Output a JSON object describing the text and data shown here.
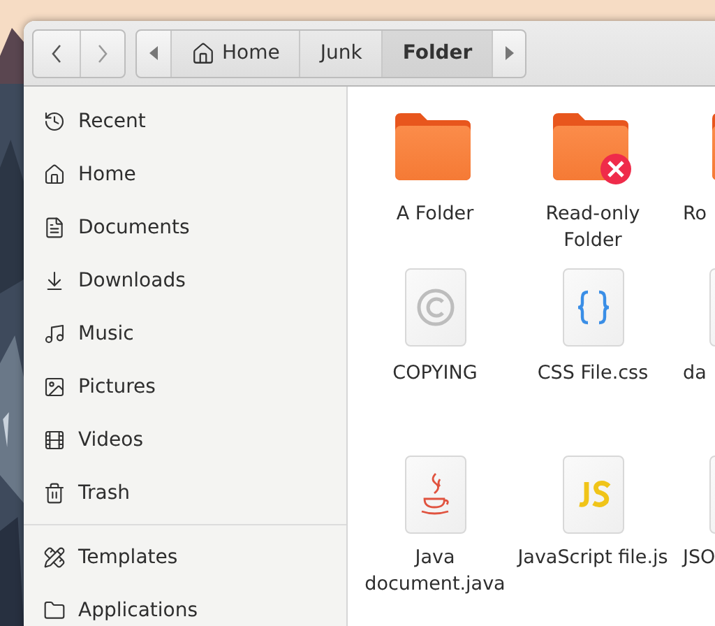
{
  "toolbar": {
    "breadcrumbs": [
      {
        "label": "Home",
        "kind": "home",
        "selected": false
      },
      {
        "label": "Junk",
        "kind": "plain",
        "selected": false
      },
      {
        "label": "Folder",
        "kind": "plain",
        "selected": true
      }
    ]
  },
  "sidebar": {
    "groups": [
      {
        "items": [
          {
            "label": "Recent",
            "kind": "recent"
          },
          {
            "label": "Home",
            "kind": "home"
          },
          {
            "label": "Documents",
            "kind": "documents"
          },
          {
            "label": "Downloads",
            "kind": "downloads"
          },
          {
            "label": "Music",
            "kind": "music"
          },
          {
            "label": "Pictures",
            "kind": "pictures"
          },
          {
            "label": "Videos",
            "kind": "videos"
          },
          {
            "label": "Trash",
            "kind": "trash"
          }
        ]
      },
      {
        "items": [
          {
            "label": "Templates",
            "kind": "templates"
          },
          {
            "label": "Applications",
            "kind": "applications"
          }
        ]
      }
    ]
  },
  "files": [
    {
      "name": "A Folder",
      "kind": "folder",
      "partial": false
    },
    {
      "name": "Read-only Folder",
      "kind": "folder-readonly",
      "partial": false
    },
    {
      "name": "Ro",
      "kind": "folder",
      "partial": true
    },
    {
      "name": "COPYING",
      "kind": "copyright",
      "partial": false
    },
    {
      "name": "CSS File.css",
      "kind": "css",
      "partial": false
    },
    {
      "name": "da",
      "kind": "blank",
      "partial": true
    },
    {
      "name": "Java document.java",
      "kind": "java",
      "partial": false
    },
    {
      "name": "JavaScript file.js",
      "kind": "js",
      "partial": false
    },
    {
      "name": "JSO",
      "kind": "blank",
      "partial": true
    }
  ]
}
